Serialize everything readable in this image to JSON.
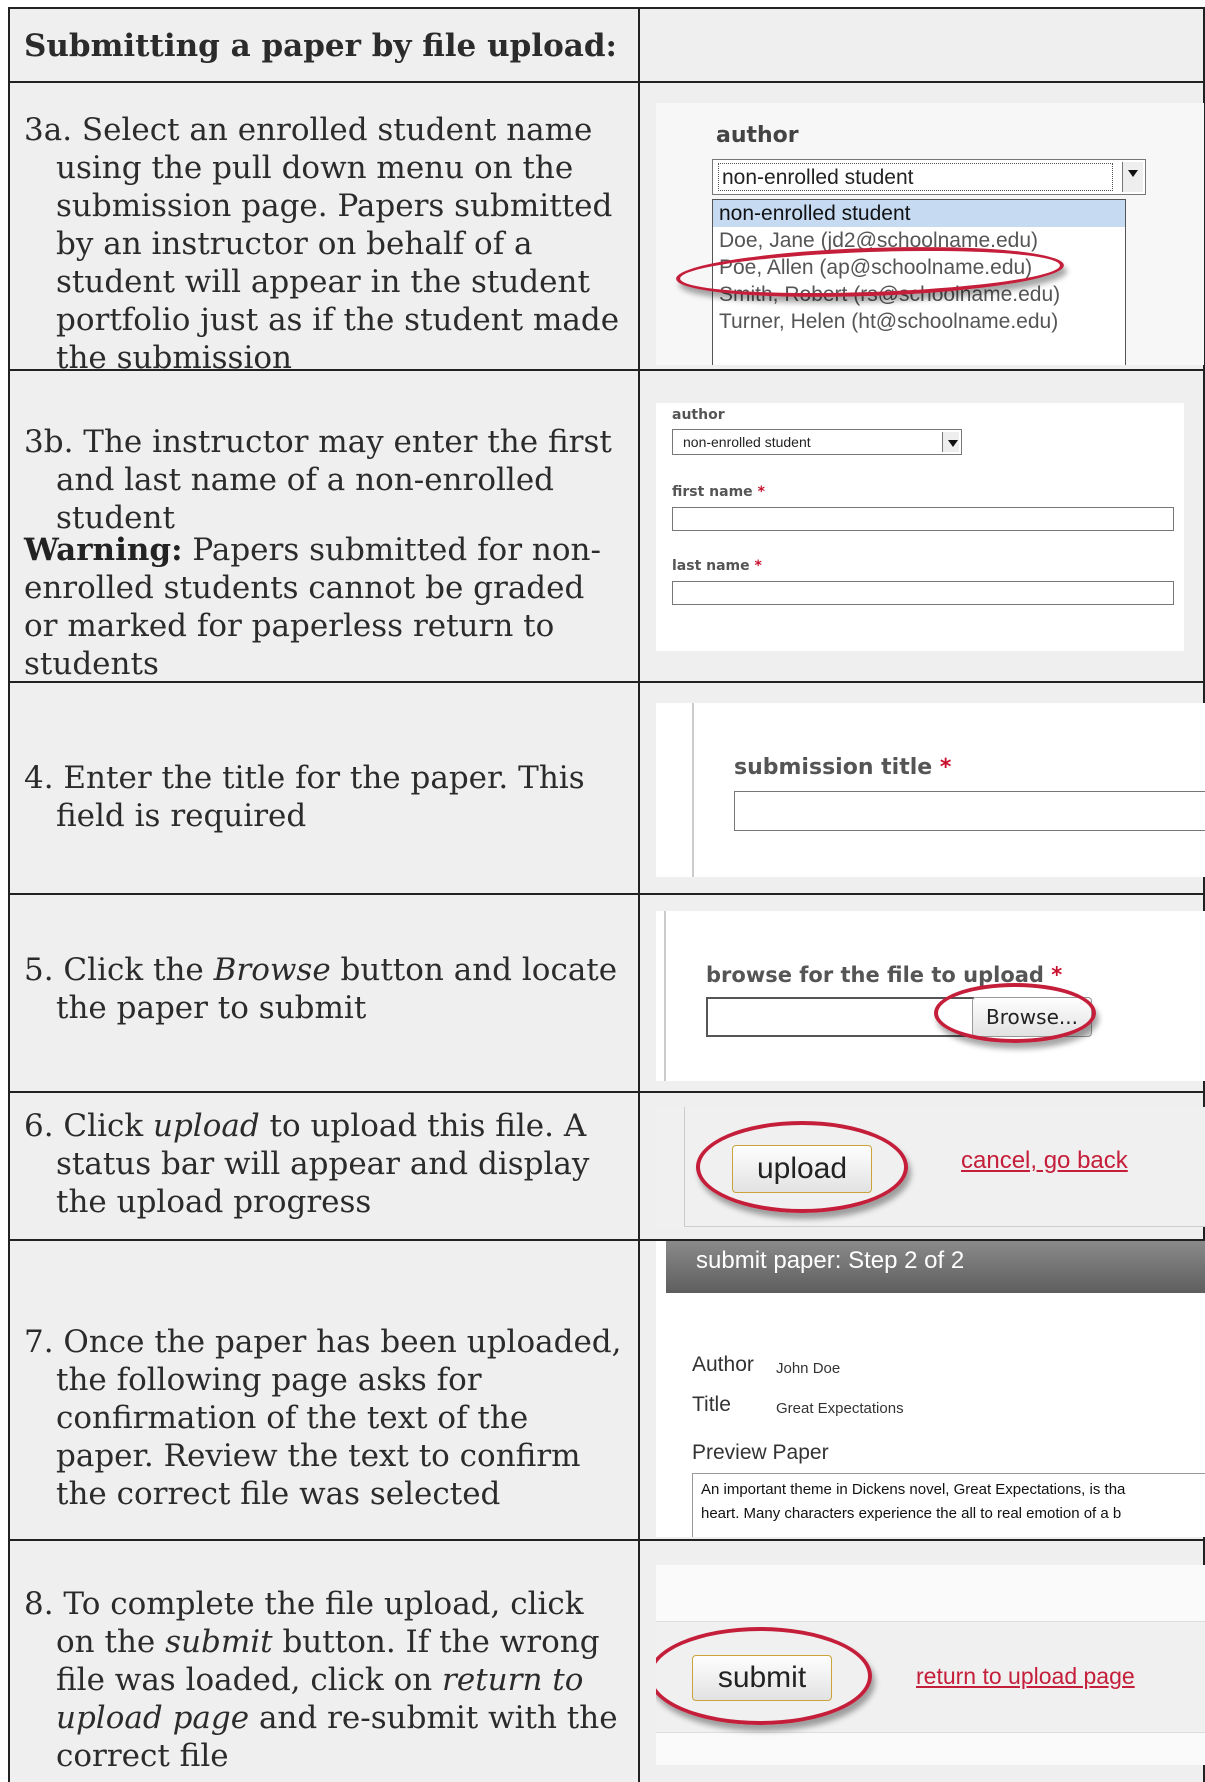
{
  "header": {
    "title": "Submitting a paper by file upload:"
  },
  "steps": {
    "s3a": {
      "text": "3a. Select an enrolled student name using the pull down menu on the submission page. Papers submitted by an instructor on behalf of a student will appear in the student portfolio just as if the student made the submission"
    },
    "s3b": {
      "text": "3b. The instructor may enter the first and last name of a non-enrolled student",
      "warning_label": "Warning:",
      "warning_text": " Papers submitted for non-enrolled students cannot be graded or marked for paperless return to students"
    },
    "s4": {
      "text": "4. Enter the title for the paper. This field is required"
    },
    "s5": {
      "pre": "5. Click the ",
      "em": "Browse",
      "post": " button and locate the paper to submit"
    },
    "s6": {
      "pre": "6. Click ",
      "em": "upload",
      "post": " to upload this file. A status bar will appear and display the upload progress"
    },
    "s7": {
      "text": "7. Once the paper has been uploaded, the following page asks for confirmation of the text of the paper. Review the text to confirm the correct file was selected"
    },
    "s8": {
      "pre": "8. To complete the file upload, click on the ",
      "em1": "submit",
      "mid": " button. If the wrong file was loaded, click on ",
      "em2": "return to upload page",
      "post": " and re-submit with the correct file"
    }
  },
  "shot3a": {
    "label": "author",
    "selected": "non-enrolled student",
    "options": [
      "non-enrolled student",
      "Doe, Jane (jd2@schoolname.edu)",
      "Poe, Allen (ap@schoolname.edu)",
      "Smith, Robert (rs@schoolname.edu)",
      "Turner, Helen (ht@schoolname.edu)"
    ]
  },
  "shot3b": {
    "author_label": "author",
    "selected": "non-enrolled student",
    "first_name_label": "first name",
    "last_name_label": "last name",
    "required_mark": "*"
  },
  "shot4": {
    "label": "submission title",
    "required_mark": "*"
  },
  "shot5": {
    "label": "browse for the file to upload",
    "required_mark": "*",
    "browse_label": "Browse..."
  },
  "shot6": {
    "upload_label": "upload",
    "cancel_label": "cancel, go back"
  },
  "shot7": {
    "heading": "submit paper: Step 2 of 2",
    "author_key": "Author",
    "author_val": "John Doe",
    "title_key": "Title",
    "title_val": "Great Expectations",
    "preview_label": "Preview Paper",
    "preview_line1": "An important theme in Dickens novel, Great Expectations, is tha",
    "preview_line2": "heart. Many characters experience the all to real emotion of a b"
  },
  "shot8": {
    "submit_label": "submit",
    "return_label": "return to upload page"
  },
  "colors": {
    "accent": "#c41e3a",
    "cell_bg": "#efefef",
    "border": "#222222"
  }
}
